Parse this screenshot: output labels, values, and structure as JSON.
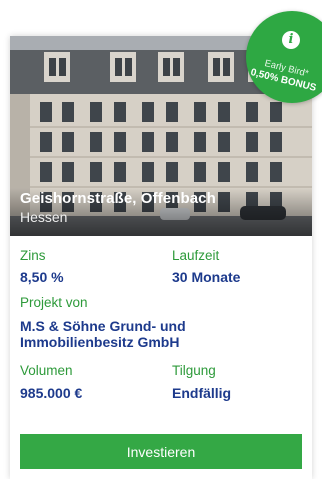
{
  "project": {
    "title": "Geishornstraße, Offenbach",
    "region": "Hessen"
  },
  "badge": {
    "icon": "info-icon",
    "line1": "Early Bird*",
    "line2": "0,50% BONUS"
  },
  "details": {
    "interest_label": "Zins",
    "interest_value": "8,50 %",
    "term_label": "Laufzeit",
    "term_value": "30 Monate",
    "developer_label": "Projekt von",
    "developer_value": "M.S & Söhne Grund- und Immobilienbesitz GmbH",
    "volume_label": "Volumen",
    "volume_value": "985.000 €",
    "repayment_label": "Tilgung",
    "repayment_value": "Endfällig"
  },
  "actions": {
    "invest_label": "Investieren"
  },
  "colors": {
    "accent_green": "#34a845",
    "value_blue": "#1d3a8c",
    "label_green": "#2d9a3a"
  }
}
